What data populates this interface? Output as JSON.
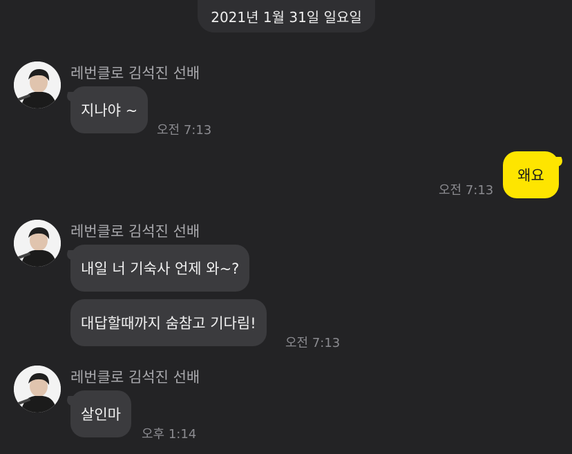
{
  "date_divider": "2021년 1월 31일 일요일",
  "sender_name": "레번클로 김석진 선배",
  "messages": [
    {
      "from": "them",
      "text": "지나야 ~",
      "time": "오전 7:13"
    },
    {
      "from": "me",
      "text": "왜요",
      "time": "오전 7:13"
    },
    {
      "from": "them",
      "text": "내일 너 기숙사 언제 와~?"
    },
    {
      "from": "them",
      "text": "대답할때까지 숨참고 기다림!",
      "time": "오전 7:13"
    },
    {
      "from": "them",
      "text": "살인마",
      "time": "오후 1:14"
    }
  ],
  "colors": {
    "background": "#232325",
    "incoming_bubble": "#3b3b3e",
    "outgoing_bubble": "#fee500"
  }
}
